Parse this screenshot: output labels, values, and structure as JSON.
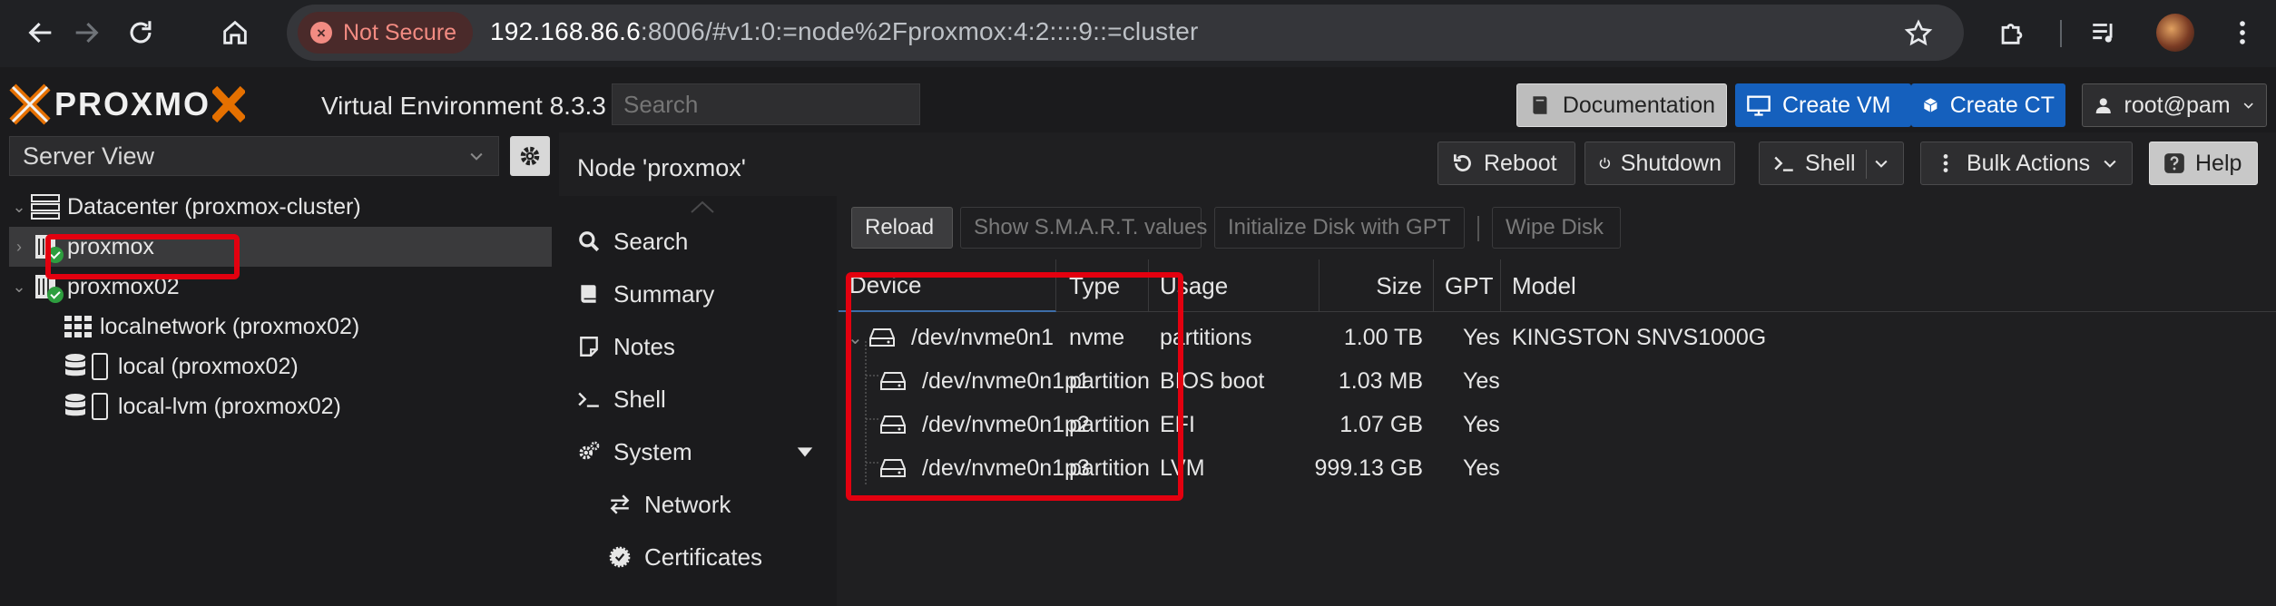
{
  "browser": {
    "not_secure": "Not Secure",
    "url_host": "192.168.86.6",
    "url_rest": ":8006/#v1:0:=node%2Fproxmox:4:2::::9::=cluster"
  },
  "header": {
    "logo_text": "PROXMO",
    "title": "Virtual Environment 8.3.3",
    "search_placeholder": "Search",
    "documentation": "Documentation",
    "create_vm": "Create VM",
    "create_ct": "Create CT",
    "user": "root@pam"
  },
  "tree": {
    "view": "Server View",
    "datacenter": "Datacenter (proxmox-cluster)",
    "node1": "proxmox",
    "node2": "proxmox02",
    "storage1": "localnetwork (proxmox02)",
    "storage2": "local (proxmox02)",
    "storage3": "local-lvm (proxmox02)"
  },
  "node": {
    "title": "Node 'proxmox'",
    "reboot": "Reboot",
    "shutdown": "Shutdown",
    "shell": "Shell",
    "bulk_actions": "Bulk Actions",
    "help": "Help"
  },
  "nav": {
    "search": "Search",
    "summary": "Summary",
    "notes": "Notes",
    "shell": "Shell",
    "system": "System",
    "network": "Network",
    "certificates": "Certificates"
  },
  "toolbar": {
    "reload": "Reload",
    "smart": "Show S.M.A.R.T. values",
    "init_gpt": "Initialize Disk with GPT",
    "wipe": "Wipe Disk"
  },
  "grid": {
    "columns": [
      "Device",
      "Type",
      "Usage",
      "Size",
      "GPT",
      "Model"
    ],
    "rows": [
      {
        "device": "/dev/nvme0n1",
        "type": "nvme",
        "usage": "partitions",
        "size": "1.00 TB",
        "gpt": "Yes",
        "model": "KINGSTON SNVS1000G"
      },
      {
        "device": "/dev/nvme0n1p1",
        "type": "partition",
        "usage": "BIOS boot",
        "size": "1.03 MB",
        "gpt": "Yes",
        "model": ""
      },
      {
        "device": "/dev/nvme0n1p2",
        "type": "partition",
        "usage": "EFI",
        "size": "1.07 GB",
        "gpt": "Yes",
        "model": ""
      },
      {
        "device": "/dev/nvme0n1p3",
        "type": "partition",
        "usage": "LVM",
        "size": "999.13 GB",
        "gpt": "Yes",
        "model": ""
      }
    ]
  },
  "colors": {
    "accent_blue": "#1560bd",
    "logo_orange": "#e57000",
    "highlight_red": "#e3000f",
    "status_green": "#2e9e3f"
  }
}
